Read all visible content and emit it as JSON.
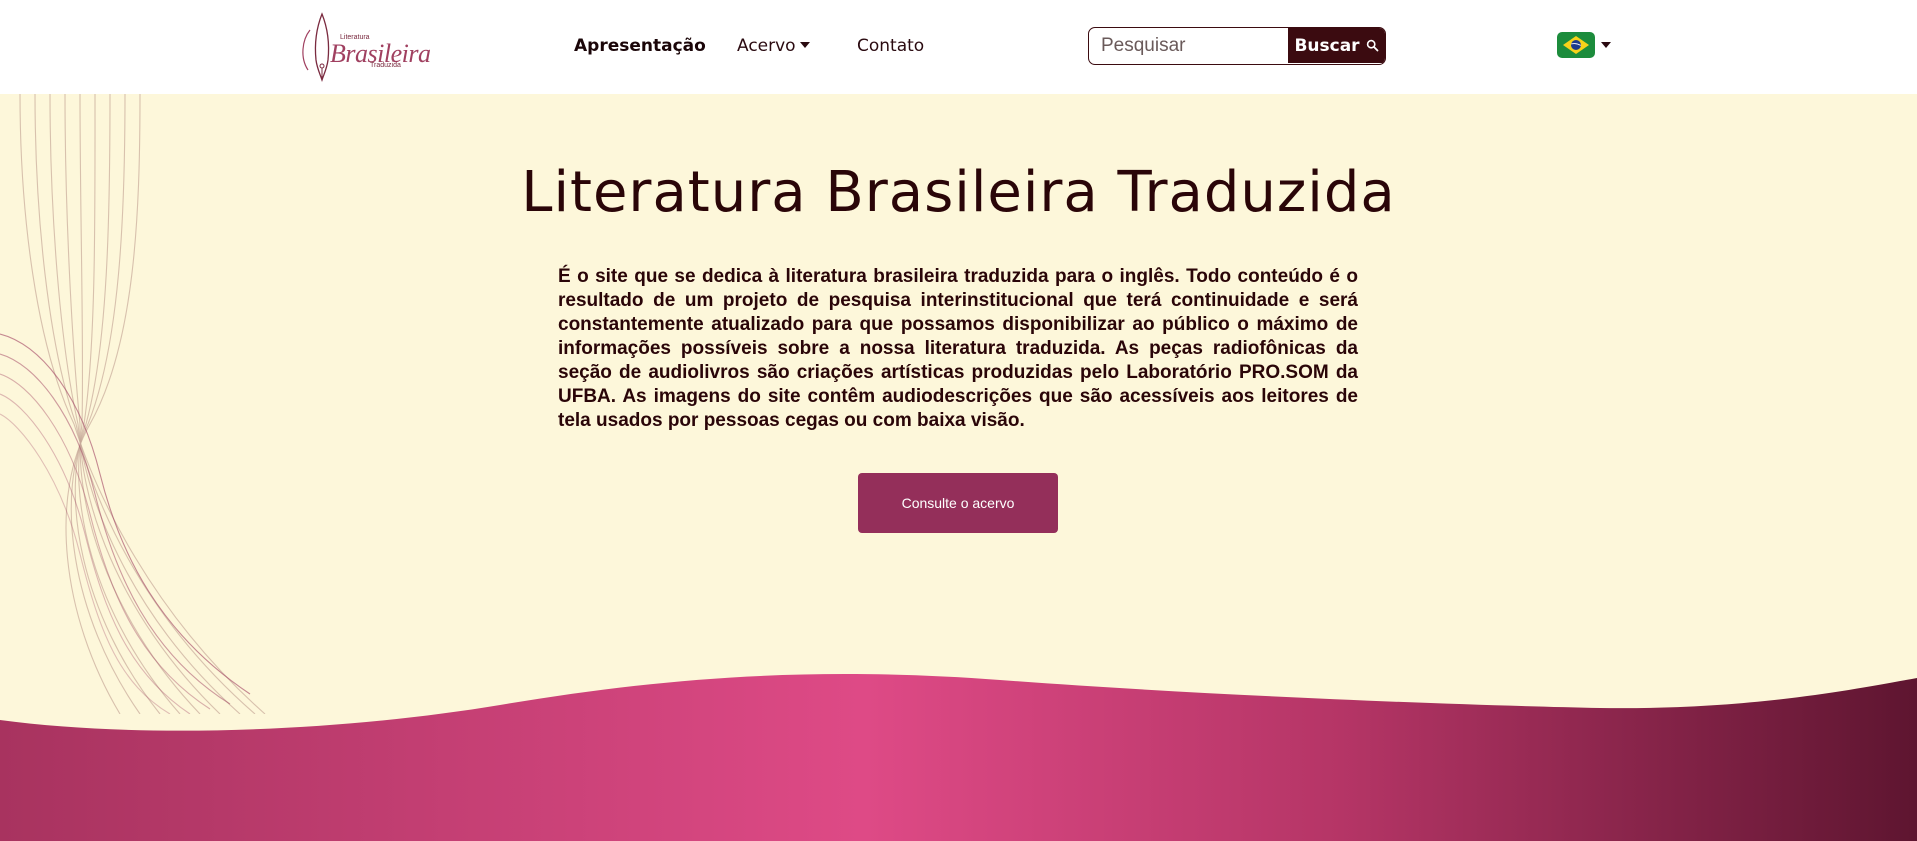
{
  "header": {
    "logo": {
      "top": "Literatura",
      "main": "Brasileira",
      "bottom": "Traduzida"
    },
    "nav": [
      {
        "label": "Apresentação",
        "active": true
      },
      {
        "label": "Acervo",
        "dropdown": true
      },
      {
        "label": "Contato"
      }
    ],
    "search": {
      "placeholder": "Pesquisar",
      "button": "Buscar",
      "icon": "search-icon"
    },
    "language": {
      "flag": "brazil-flag-icon"
    }
  },
  "hero": {
    "title": "Literatura Brasileira Traduzida",
    "text": "É o site que se dedica à literatura brasileira traduzida para o inglês. Todo conteúdo é o resultado de um projeto de pesquisa interinstitucional que terá continuidade e será constantemente atualizado para que possamos disponibilizar ao público o máximo de informações possíveis sobre a nossa literatura traduzida. As peças radiofônicas da seção de audiolivros são criações artísticas produzidas pelo Laboratório PRO.SOM da UFBA. As imagens do site contêm audiodescrições que são acessíveis aos leitores de tela usados por pessoas cegas ou com baixa visão.",
    "cta": "Consulte o acervo"
  },
  "colors": {
    "background": "#fdf7da",
    "primary": "#3b0b10",
    "accent": "#942f5a",
    "wave_start": "#a8335f",
    "wave_mid": "#de4a86",
    "wave_end": "#5e1530"
  }
}
